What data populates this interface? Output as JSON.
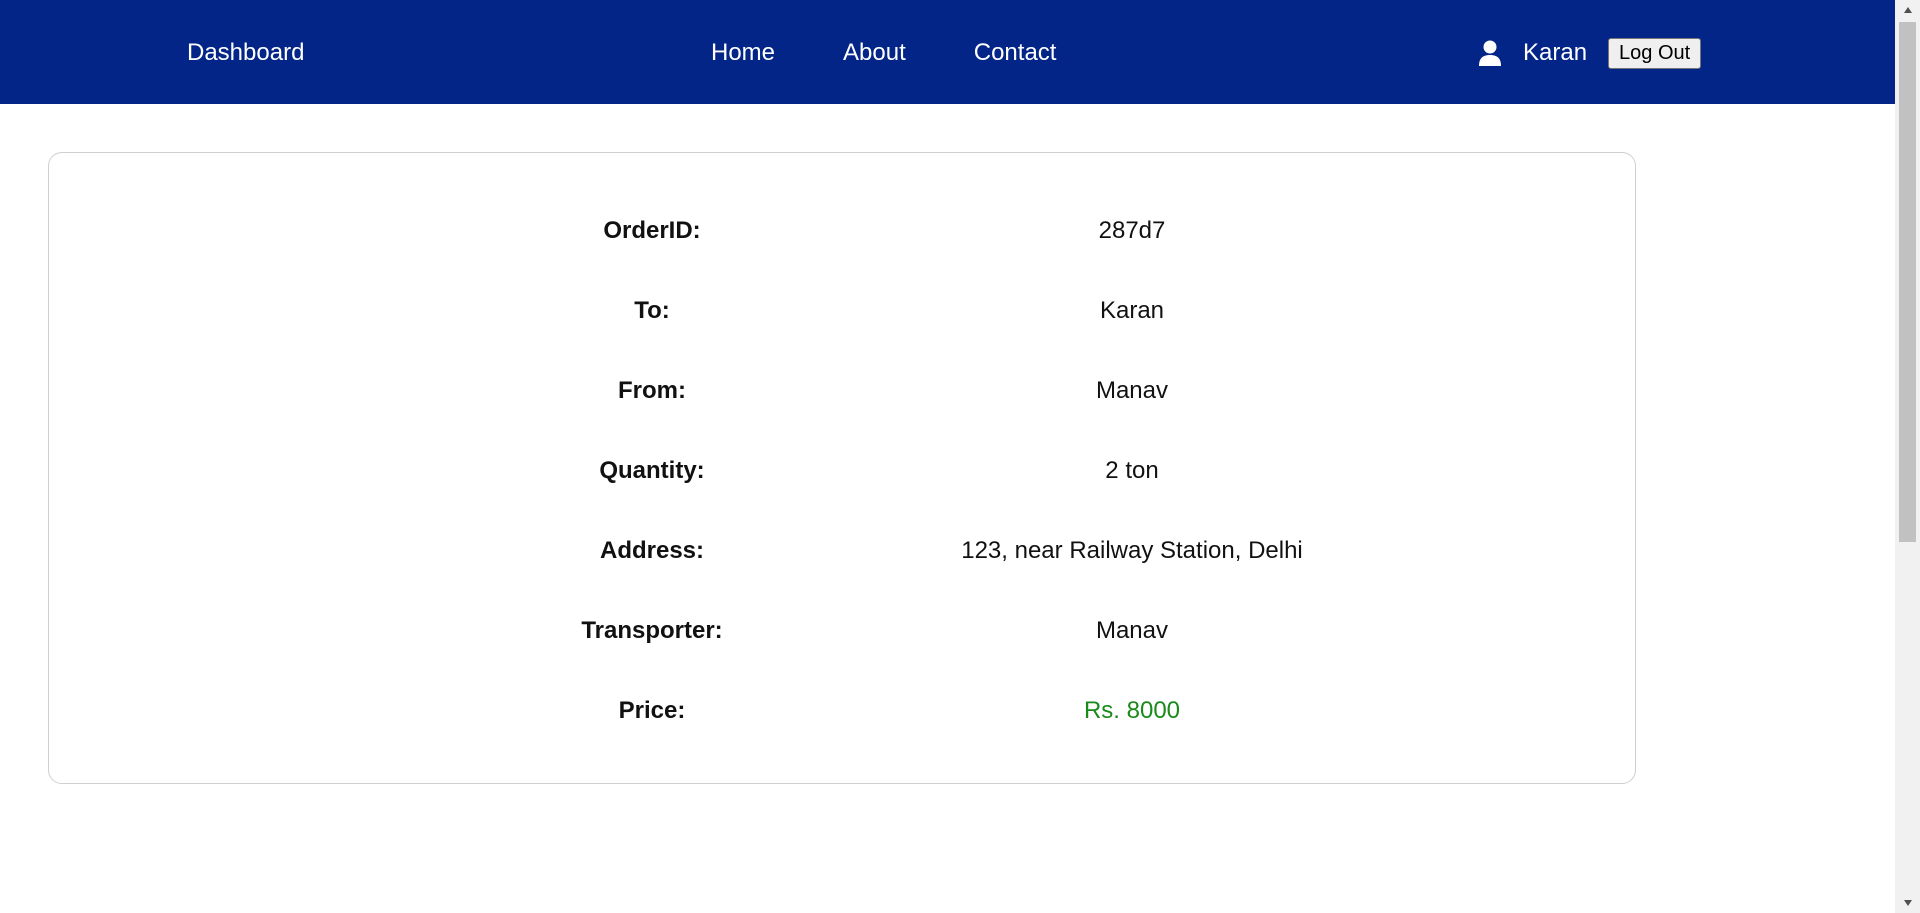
{
  "navbar": {
    "brand": "Dashboard",
    "links": [
      {
        "label": "Home"
      },
      {
        "label": "About"
      },
      {
        "label": "Contact"
      }
    ],
    "user": {
      "icon": "user-icon",
      "name": "Karan"
    },
    "logout_label": "Log Out"
  },
  "order": {
    "rows": [
      {
        "label": "OrderID:",
        "value": "287d7"
      },
      {
        "label": "To:",
        "value": "Karan"
      },
      {
        "label": "From:",
        "value": "Manav"
      },
      {
        "label": "Quantity:",
        "value": "2 ton"
      },
      {
        "label": "Address:",
        "value": "123, near Railway Station, Delhi"
      },
      {
        "label": "Transporter:",
        "value": "Manav"
      },
      {
        "label": "Price:",
        "value": "Rs. 8000"
      }
    ]
  },
  "colors": {
    "navbar_bg": "#032587",
    "price_text": "#1a8a1a",
    "card_border": "#cfcfcf"
  }
}
